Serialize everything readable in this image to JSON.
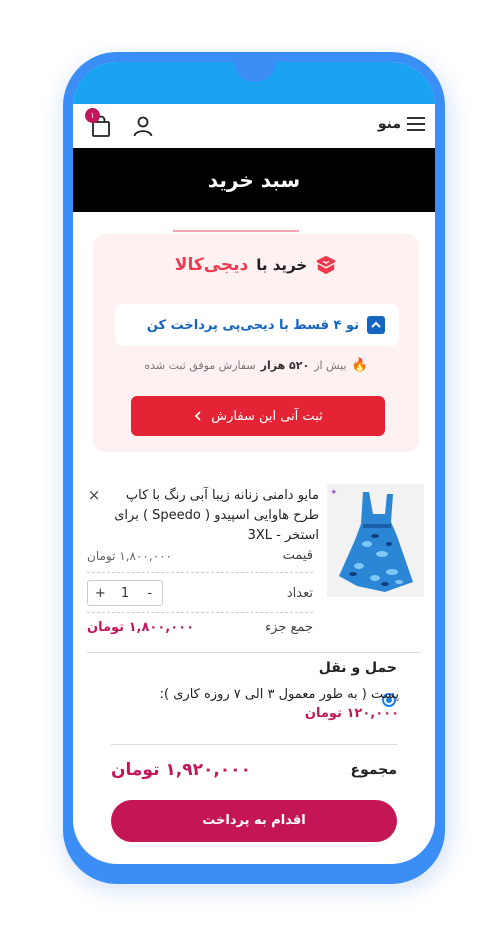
{
  "header": {
    "menu_label": "منو",
    "cart_count": "۱"
  },
  "page_title": "سبد خرید",
  "digikala": {
    "prefix": "خرید با",
    "logo_text": "دیجی‌کالا",
    "installment": "تو ۴ قسط با دیجی‌پی پرداخت کن",
    "stat_prefix": "بیش از",
    "stat_value": "۵۲۰ هزار",
    "stat_suffix": "سفارش موفق ثبت شده",
    "button_label": "ثبت آنی این سفارش"
  },
  "cart_item": {
    "title": "مایو دامنی زنانه زیبا آبی رنگ با کاپ طرح هاوایی اسپیدو ( Speedo ) برای استخر - 3XL",
    "price_label": "قیمت",
    "price_value": "۱,۸۰۰,۰۰۰ تومان",
    "qty_label": "تعداد",
    "qty_value": "1",
    "qty_minus": "-",
    "qty_plus": "+",
    "subtotal_label": "جمع جزء",
    "subtotal_value": "۱,۸۰۰,۰۰۰ تومان"
  },
  "shipping": {
    "title": "حمل و نقل",
    "option_name": "پست ( به طور معمول ۳ الی ۷ روزه کاری ):",
    "option_price": "۱۲۰,۰۰۰ تومان"
  },
  "total": {
    "label": "مجموع",
    "value": "۱,۹۲۰,۰۰۰ تومان"
  },
  "checkout_label": "اقدام به پرداخت",
  "colors": {
    "phone_frame": "#3b8ef5",
    "status_bar": "#1aa3f0",
    "accent": "#c41656",
    "digikala_red": "#e42434",
    "link_blue": "#1565c0"
  }
}
